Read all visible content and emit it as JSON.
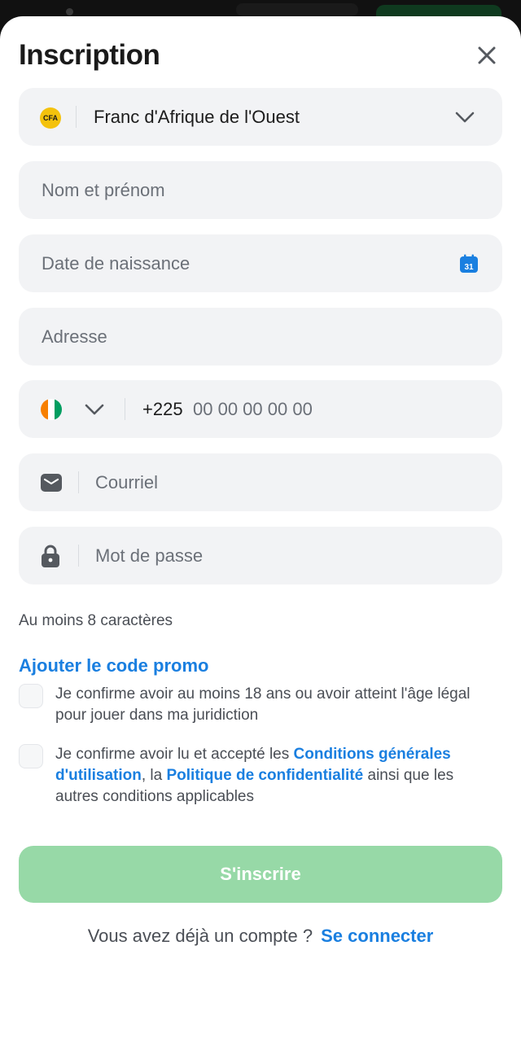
{
  "header": {
    "title": "Inscription"
  },
  "currency": {
    "badge": "CFA",
    "label": "Franc d'Afrique de l'Ouest"
  },
  "fields": {
    "name_placeholder": "Nom et prénom",
    "birthdate_placeholder": "Date de naissance",
    "calendar_day": "31",
    "address_placeholder": "Adresse",
    "phone_prefix": "+225",
    "phone_placeholder": "00 00 00 00 00",
    "email_placeholder": "Courriel",
    "password_placeholder": "Mot de passe"
  },
  "password_hint": "Au moins 8 caractères",
  "promo_link": "Ajouter le code promo",
  "consents": {
    "age": "Je confirme avoir au moins 18 ans ou avoir atteint l'âge légal pour jouer dans ma juridiction",
    "terms_prefix": "Je confirme avoir lu et accepté les ",
    "terms_link": "Conditions générales d'utilisation",
    "terms_mid": ", la ",
    "privacy_link": "Politique de confidentialité",
    "terms_suffix": " ainsi que les autres conditions applicables"
  },
  "submit_label": "S'inscrire",
  "login": {
    "prompt": "Vous avez déjà un compte ?",
    "link": "Se connecter"
  },
  "colors": {
    "accent_blue": "#1a7fe0",
    "submit_disabled_green": "#97d9a7",
    "field_bg": "#f2f3f5",
    "cfa_badge": "#f4c20d",
    "flag_orange": "#f77f00",
    "flag_white": "#ffffff",
    "flag_green": "#009e60"
  },
  "icons": {
    "close": "close-icon",
    "currency_dropdown": "chevron-down-icon",
    "calendar": "calendar-icon",
    "country_flag": "ivory-coast-flag-icon",
    "country_dropdown": "chevron-down-icon",
    "email": "envelope-icon",
    "password": "lock-icon"
  }
}
